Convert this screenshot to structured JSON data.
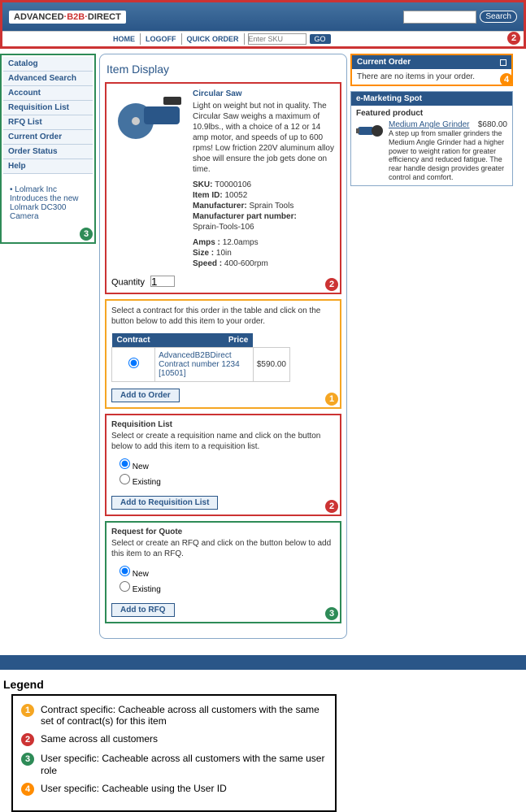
{
  "brand": {
    "left": "ADVANCED",
    "mid": "B2B",
    "right": "DIRECT"
  },
  "header": {
    "search_label": "Search",
    "nav": {
      "home": "HOME",
      "logoff": "LOGOFF",
      "quick_order": "QUICK ORDER"
    },
    "sku_ph": "Enter SKU",
    "go": "GO"
  },
  "sidebar": {
    "items": [
      "Catalog",
      "Advanced Search",
      "Account",
      "Requisition List",
      "RFQ List",
      "Current Order",
      "Order Status",
      "Help"
    ],
    "news": "Lolmark Inc Introduces the new Lolmark DC300 Camera"
  },
  "center": {
    "title": "Item Display",
    "product": {
      "name": "Circular Saw",
      "desc": "Light on weight but not in quality. The Circular Saw weighs a maximum of 10.9lbs., with a choice of a 12 or 14 amp motor, and speeds of up to 600 rpms! Low friction 220V aluminum alloy shoe will ensure the job gets done on time.",
      "sku_label": "SKU:",
      "sku": "T0000106",
      "itemid_label": "Item ID:",
      "itemid": "10052",
      "mfr_label": "Manufacturer:",
      "mfr": "Sprain Tools",
      "mpn_label": "Manufacturer part number:",
      "mpn": "Sprain-Tools-106",
      "amps_label": "Amps :",
      "amps": "12.0amps",
      "size_label": "Size :",
      "size": "10in",
      "speed_label": "Speed :",
      "speed": "400-600rpm",
      "qty_label": "Quantity",
      "qty_val": "1"
    },
    "contract": {
      "desc": "Select a contract for this order in the table and click on the button below to add this item to your order.",
      "col_contract": "Contract",
      "col_price": "Price",
      "name": "AdvancedB2BDirect Contract number 1234 [10501]",
      "price": "$590.00",
      "btn": "Add to Order"
    },
    "req": {
      "title": "Requisition List",
      "desc": "Select or create a requisition name and click on the button below to add this item to a requisition list.",
      "opt_new": "New",
      "opt_existing": "Existing",
      "btn": "Add to Requisition List"
    },
    "rfq": {
      "title": "Request for Quote",
      "desc": "Select or create an RFQ and click on the button below to add this item to an RFQ.",
      "opt_new": "New",
      "opt_existing": "Existing",
      "btn": "Add to RFQ"
    }
  },
  "right": {
    "order": {
      "title": "Current Order",
      "body": "There are no items in your order."
    },
    "spot": {
      "title": "e-Marketing Spot",
      "featured_label": "Featured product",
      "name": "Medium Angle Grinder",
      "price": "$680.00",
      "desc": "A step up from smaller grinders the Medium Angle Grinder had a higher power to weight ration for greater efficiency and reduced fatigue. The rear handle design provides greater control and comfort."
    }
  },
  "legend": {
    "title": "Legend",
    "items": [
      {
        "n": "1",
        "color": "#f5a623",
        "text": "Contract specific: Cacheable across all customers with the same set of contract(s) for this item"
      },
      {
        "n": "2",
        "color": "#cc3333",
        "text": "Same across all customers"
      },
      {
        "n": "3",
        "color": "#2e8b57",
        "text": "User specific: Cacheable across all customers with the same user role"
      },
      {
        "n": "4",
        "color": "#ff8c00",
        "text": "User specific: Cacheable using the User ID"
      }
    ]
  }
}
